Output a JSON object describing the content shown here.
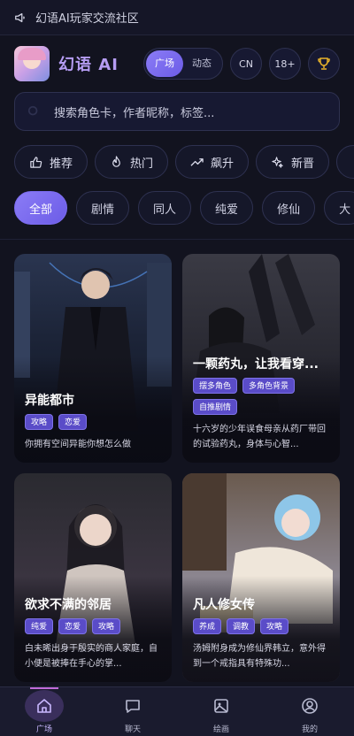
{
  "notice": {
    "text": "幻语AI玩家交流社区"
  },
  "header": {
    "brand": "幻语 AI",
    "seg": [
      "广场",
      "动态"
    ],
    "lang": "CN",
    "age": "18+",
    "trophy_icon": "trophy-icon"
  },
  "search": {
    "placeholder": "搜索角色卡，作者昵称，标签..."
  },
  "chips": [
    {
      "label": "推荐",
      "icon": "thumbs-up-icon"
    },
    {
      "label": "热门",
      "icon": "flame-icon"
    },
    {
      "label": "飙升",
      "icon": "trending-up-icon"
    },
    {
      "label": "新晋",
      "icon": "sparkle-icon"
    }
  ],
  "tabs": [
    "全部",
    "剧情",
    "同人",
    "纯爱",
    "修仙",
    "大"
  ],
  "cards": [
    {
      "title": "异能都市",
      "tags": [
        "攻略",
        "恋爱"
      ],
      "desc": "你拥有空间异能你想怎么做"
    },
    {
      "title": "一颗药丸，让我看穿...",
      "tags": [
        "摆多角色",
        "多角色背景",
        "自推剧情"
      ],
      "desc": "十六岁的少年误食母亲从药厂带回的试验药丸，身体与心智..."
    },
    {
      "title": "欲求不满的邻居",
      "tags": [
        "纯爱",
        "恋爱",
        "攻略"
      ],
      "desc": "白未晞出身于殷实的商人家庭，自小便是被捧在手心的掌..."
    },
    {
      "title": "凡人修女传",
      "tags": [
        "养成",
        "调教",
        "攻略"
      ],
      "desc": "汤姆附身成为修仙界韩立，意外得到一个戒指具有特殊功..."
    }
  ],
  "nav": [
    {
      "label": "广场",
      "icon": "home-icon"
    },
    {
      "label": "聊天",
      "icon": "chat-icon"
    },
    {
      "label": "绘画",
      "icon": "image-icon"
    },
    {
      "label": "我的",
      "icon": "user-icon"
    }
  ],
  "colors": {
    "accent": "#8b7cf6",
    "background": "#12131f",
    "tag": "#5a4cc8"
  }
}
